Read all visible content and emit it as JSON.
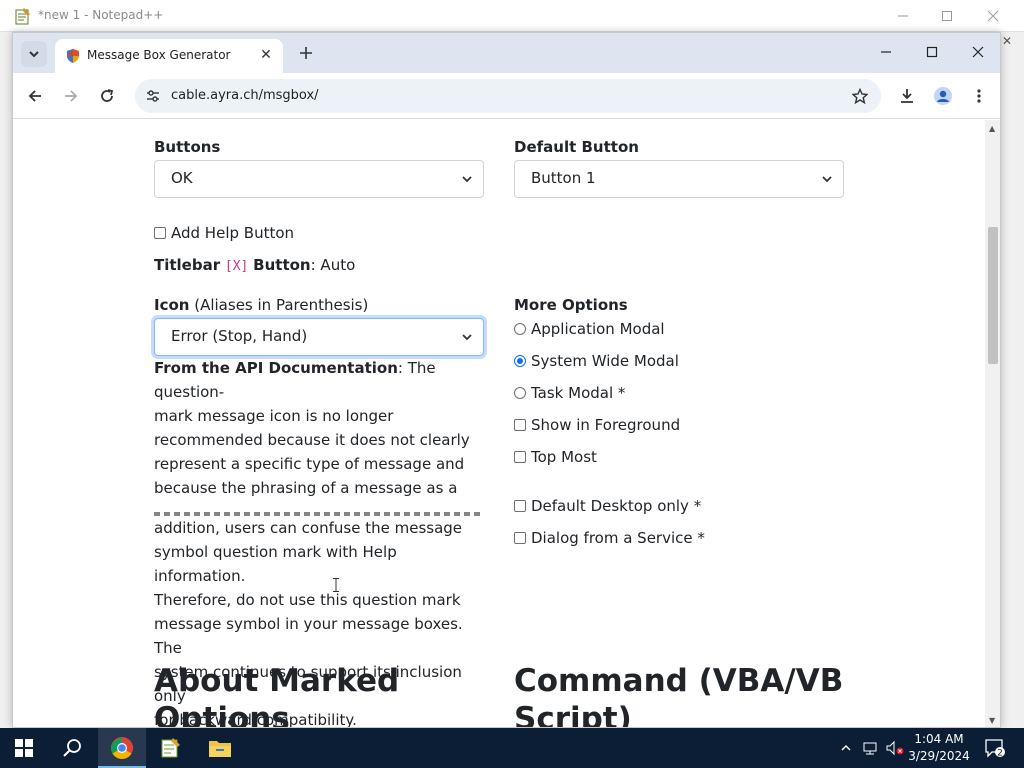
{
  "notepad": {
    "title": "*new 1 - Notepad++"
  },
  "browser": {
    "tab_title": "Message Box Generator",
    "url": "cable.ayra.ch/msgbox/"
  },
  "form": {
    "buttons_label": "Buttons",
    "buttons_value": "OK",
    "default_button_label": "Default Button",
    "default_button_value": "Button 1",
    "add_help_label": "Add Help Button",
    "add_help_checked": false,
    "titlebar_prefix": "Titlebar",
    "titlebar_code": "[X]",
    "titlebar_mid": "Button",
    "titlebar_value": ": Auto",
    "icon_label": "Icon",
    "icon_label_note": " (Aliases in Parenthesis)",
    "icon_value": "Error (Stop, Hand)",
    "more_options_label": "More Options",
    "radio_options": [
      {
        "label": "Application Modal",
        "checked": false
      },
      {
        "label": "System Wide Modal",
        "checked": true
      },
      {
        "label": "Task Modal *",
        "checked": false
      }
    ],
    "checkbox_options": [
      {
        "label": "Show in Foreground",
        "checked": false
      },
      {
        "label": "Top Most",
        "checked": false
      },
      {
        "label": "Default Desktop only *",
        "checked": false
      },
      {
        "label": "Dialog from a Service *",
        "checked": false
      }
    ]
  },
  "api_doc": {
    "heading": "From the API Documentation",
    "lines_top": [
      ": The question-",
      "mark message icon is no longer",
      "recommended because it does not clearly",
      "represent a specific type of message and",
      "because the phrasing of a message as a"
    ],
    "lines_bottom": [
      "addition, users can confuse the message",
      "symbol question mark with Help information.",
      "Therefore, do not use this question mark",
      "message symbol in your message boxes. The",
      "system continues to support its inclusion only",
      "for backward compatibility."
    ]
  },
  "sections": {
    "about_heading_1": "About Marked",
    "about_heading_2": "Options",
    "command_heading_1": "Command (VBA/VB",
    "command_heading_2": "Script)"
  },
  "taskbar": {
    "time": "1:04 AM",
    "date": "3/29/2024",
    "notification_count": "2"
  },
  "colors": {
    "accent": "#0d6efd",
    "taskbar": "#0c1e35",
    "tabstrip": "#dfe5f0",
    "code": "#d63384"
  }
}
